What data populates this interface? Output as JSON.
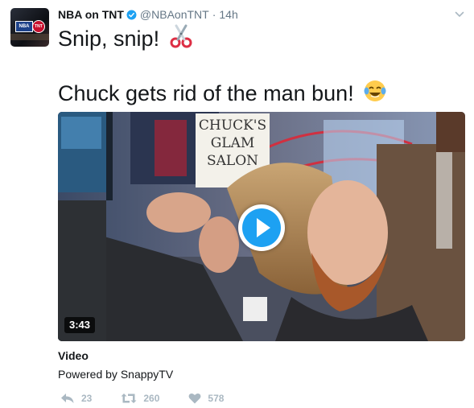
{
  "tweet": {
    "author_name": "NBA on TNT",
    "handle": "@NBAonTNT",
    "separator": "·",
    "time": "14h",
    "text_line1": "Snip, snip!",
    "text_line2": "Chuck gets rid of the man bun!",
    "emoji_line1": "scissors-emoji",
    "emoji_line2": "tears-of-joy-emoji"
  },
  "avatar": {
    "logo_left": "NBA",
    "logo_right": "TNT"
  },
  "media": {
    "sign_lines": [
      "CHUCK'S",
      "GLAM",
      "SALON"
    ],
    "duration": "3:43",
    "play_icon": "play-icon"
  },
  "card": {
    "title": "Video",
    "subtitle": "Powered by SnappyTV"
  },
  "actions": {
    "reply_count": "23",
    "retweet_count": "260",
    "like_count": "578"
  },
  "colors": {
    "text": "#14171a",
    "secondary": "#657786",
    "action_gray": "#aab8c2",
    "twitter_blue": "#1da1f2",
    "verified_blue": "#1da1f2"
  }
}
